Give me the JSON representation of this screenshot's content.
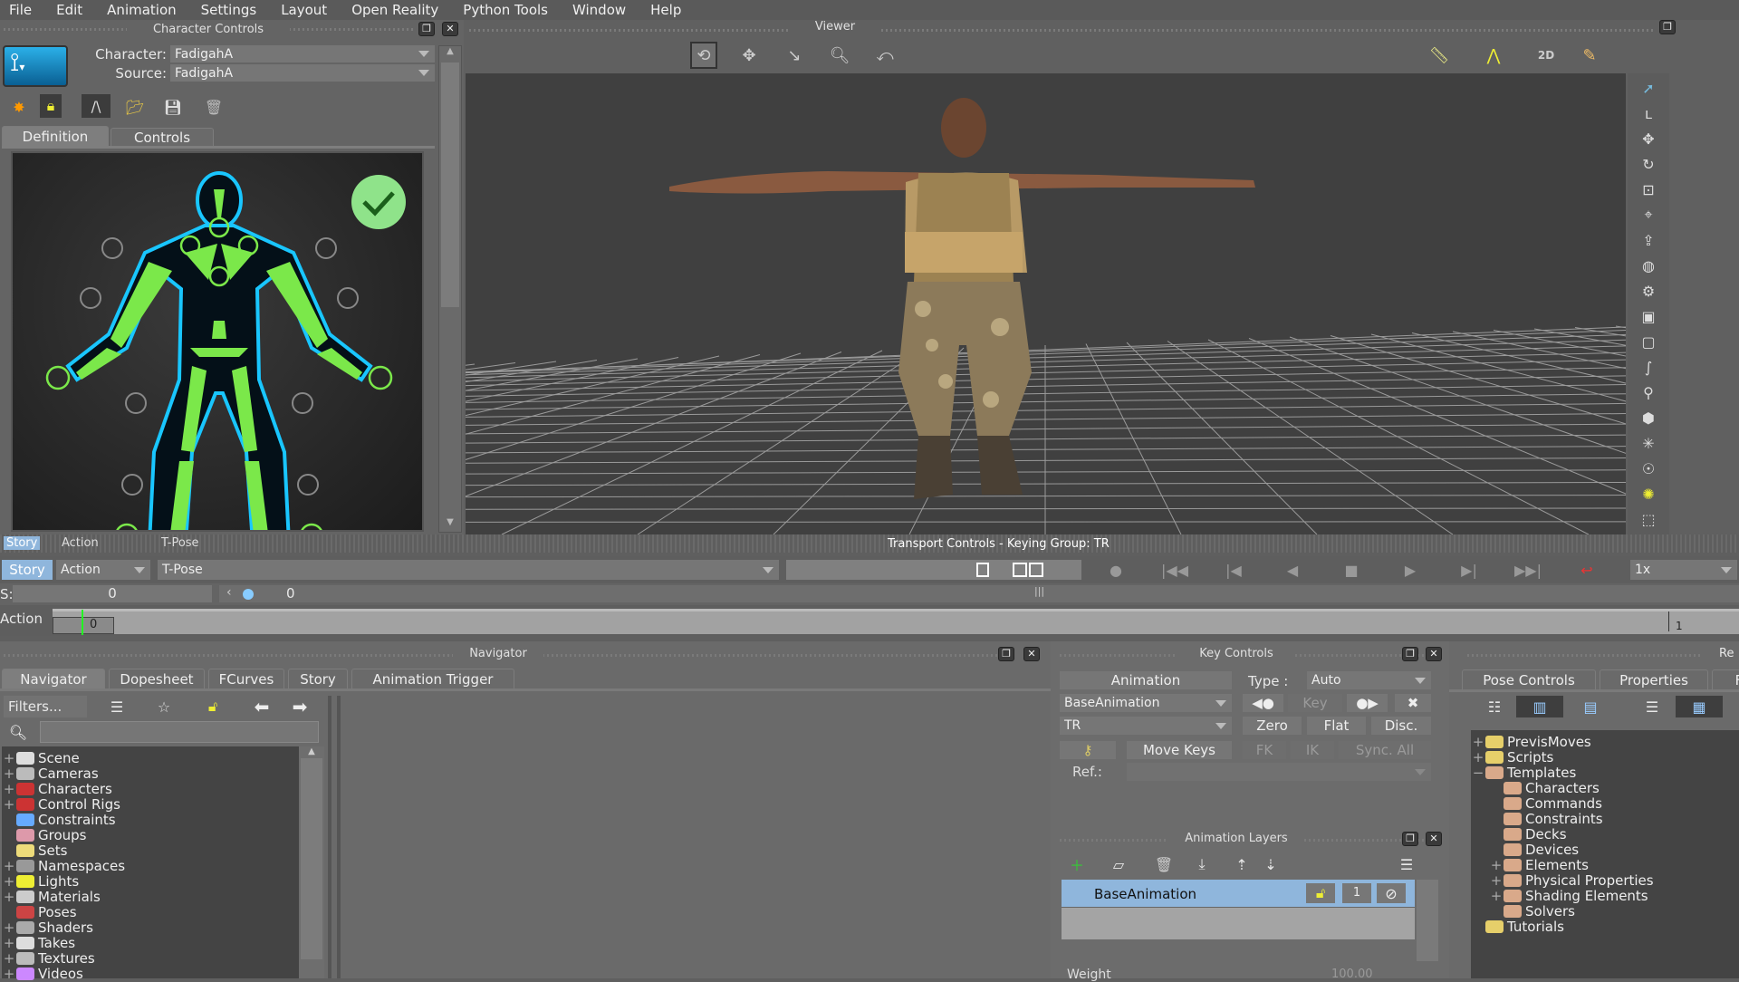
{
  "menu": [
    "File",
    "Edit",
    "Animation",
    "Settings",
    "Layout",
    "Open Reality",
    "Python Tools",
    "Window",
    "Help"
  ],
  "character_controls": {
    "title": "Character Controls",
    "character_label": "Character:",
    "character_value": "FadigahA",
    "source_label": "Source:",
    "source_value": "FadigahA",
    "tabs": [
      "Definition",
      "Controls"
    ],
    "toolbar_icons": [
      "star-burst-icon",
      "lock-icon",
      "bones-icon",
      "open-folder-icon",
      "save-icon",
      "trash-icon"
    ]
  },
  "viewer": {
    "title": "Viewer",
    "tools": [
      "orbit-icon",
      "pan-icon",
      "dolly-icon",
      "zoom-icon",
      "roll-icon"
    ],
    "right_tools": [
      "ruler-icon",
      "curve-points-icon",
      "2d-magnifier-icon",
      "sketch-icon"
    ]
  },
  "ghost_bar": {
    "story": "Story",
    "action": "Action",
    "pose": "T-Pose",
    "transport_title": "Transport Controls - Keying Group: TR"
  },
  "story_bar": {
    "story": "Story",
    "action": "Action",
    "pose": "T-Pose",
    "speed": "1x"
  },
  "time_row": {
    "label": "S:",
    "start": "0",
    "current": "0"
  },
  "action_track": {
    "label": "Action",
    "clip_start": "0",
    "end_marker": "1"
  },
  "navigator": {
    "title": "Navigator",
    "tabs": [
      "Navigator",
      "Dopesheet",
      "FCurves",
      "Story",
      "Animation Trigger"
    ],
    "filters": "Filters...",
    "search_placeholder": "",
    "items": [
      {
        "label": "Scene",
        "exp": "+",
        "color": "#ddd"
      },
      {
        "label": "Cameras",
        "exp": "+",
        "color": "#bbb"
      },
      {
        "label": "Characters",
        "exp": "+",
        "color": "#c33"
      },
      {
        "label": "Control Rigs",
        "exp": "+",
        "color": "#c33"
      },
      {
        "label": "Constraints",
        "exp": "",
        "color": "#6af"
      },
      {
        "label": "Groups",
        "exp": "",
        "color": "#d9a"
      },
      {
        "label": "Sets",
        "exp": "",
        "color": "#eddb7a"
      },
      {
        "label": "Namespaces",
        "exp": "+",
        "color": "#999"
      },
      {
        "label": "Lights",
        "exp": "+",
        "color": "#ee3"
      },
      {
        "label": "Materials",
        "exp": "+",
        "color": "#ccc"
      },
      {
        "label": "Poses",
        "exp": "",
        "color": "#c44"
      },
      {
        "label": "Shaders",
        "exp": "+",
        "color": "#aaa"
      },
      {
        "label": "Takes",
        "exp": "+",
        "color": "#ddd"
      },
      {
        "label": "Textures",
        "exp": "+",
        "color": "#bbb"
      },
      {
        "label": "Videos",
        "exp": "+",
        "color": "#c8f"
      }
    ]
  },
  "key_controls": {
    "title": "Key Controls",
    "mode": "Animation",
    "type_label": "Type :",
    "type_value": "Auto",
    "layer": "BaseAnimation",
    "key": "Key",
    "group": "TR",
    "zero": "Zero",
    "flat": "Flat",
    "disc": "Disc.",
    "move_keys": "Move Keys",
    "fk": "FK",
    "ik": "IK",
    "sync_all": "Sync. All",
    "ref_label": "Ref.:"
  },
  "animation_layers": {
    "title": "Animation Layers",
    "layers": [
      "BaseAnimation"
    ],
    "weight_label": "Weight",
    "weight_value": "100.00",
    "layer_number": "1"
  },
  "resources": {
    "title": "Re",
    "tabs": [
      "Pose Controls",
      "Properties",
      "F"
    ],
    "items": [
      {
        "label": "PrevisMoves",
        "exp": "+",
        "kind": "folder",
        "depth": 0
      },
      {
        "label": "Scripts",
        "exp": "+",
        "kind": "folder",
        "depth": 0
      },
      {
        "label": "Templates",
        "exp": "−",
        "kind": "group",
        "depth": 0
      },
      {
        "label": "Characters",
        "exp": "",
        "kind": "group",
        "depth": 1
      },
      {
        "label": "Commands",
        "exp": "",
        "kind": "group",
        "depth": 1
      },
      {
        "label": "Constraints",
        "exp": "",
        "kind": "group",
        "depth": 1
      },
      {
        "label": "Decks",
        "exp": "",
        "kind": "group",
        "depth": 1
      },
      {
        "label": "Devices",
        "exp": "",
        "kind": "group",
        "depth": 1
      },
      {
        "label": "Elements",
        "exp": "+",
        "kind": "group",
        "depth": 1
      },
      {
        "label": "Physical Properties",
        "exp": "+",
        "kind": "group",
        "depth": 1
      },
      {
        "label": "Shading Elements",
        "exp": "+",
        "kind": "group",
        "depth": 1
      },
      {
        "label": "Solvers",
        "exp": "",
        "kind": "group",
        "depth": 1
      },
      {
        "label": "Tutorials",
        "exp": "",
        "kind": "folder",
        "depth": 0
      }
    ]
  },
  "colors": {
    "accent_green": "#7be84a",
    "cyan": "#19c6ff",
    "selected": "#8fb6dc"
  }
}
